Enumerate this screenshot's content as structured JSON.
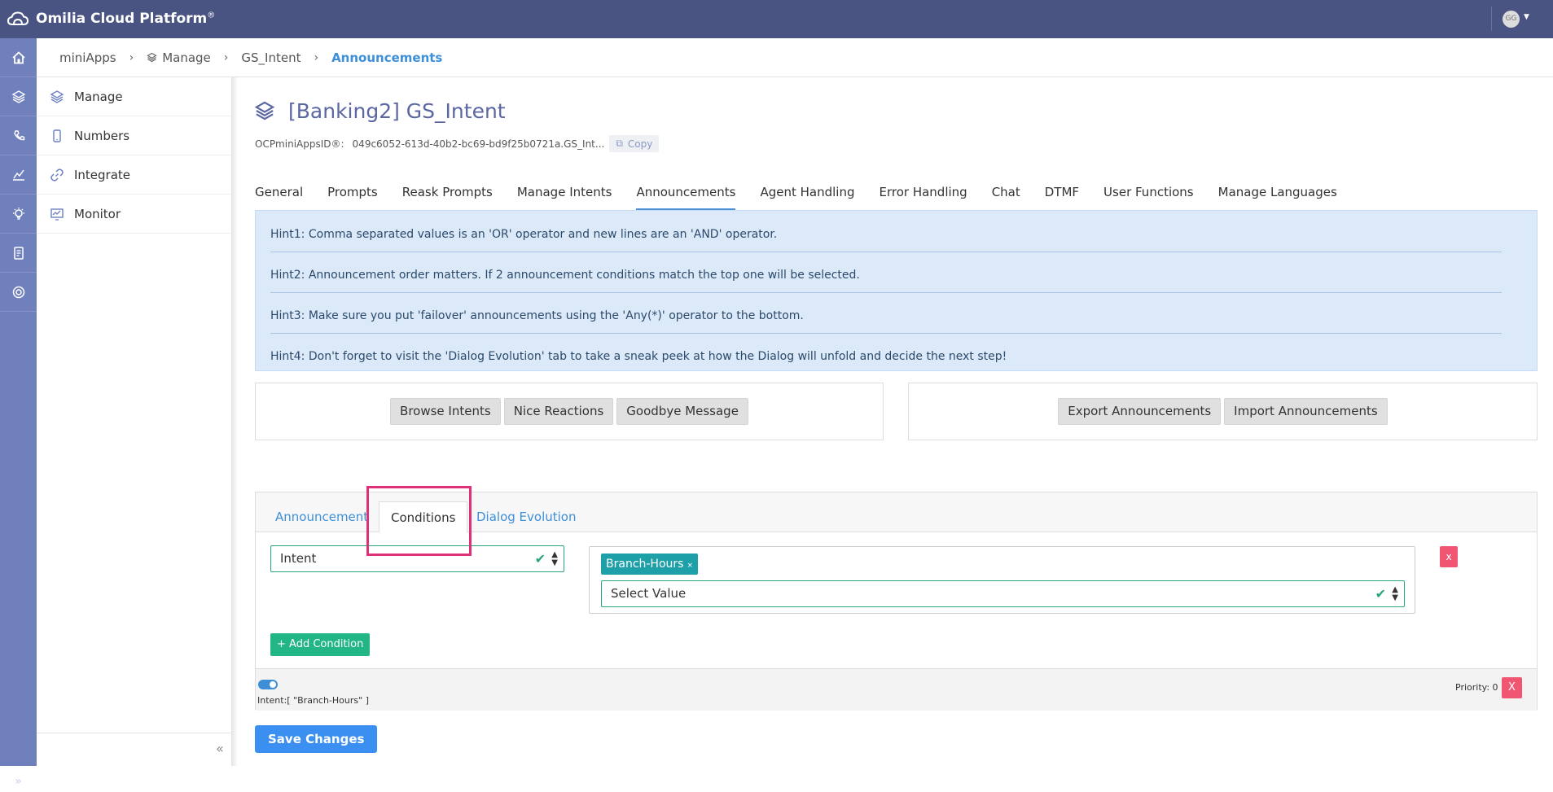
{
  "app": {
    "title": "Omilia Cloud Platform",
    "title_mark": "®",
    "avatar_initials": "GG"
  },
  "breadcrumb": [
    "miniApps",
    "Manage",
    "GS_Intent",
    "Announcements"
  ],
  "sidebar": {
    "items": [
      {
        "label": "Manage",
        "icon": "layers-icon"
      },
      {
        "label": "Numbers",
        "icon": "phone-icon"
      },
      {
        "label": "Integrate",
        "icon": "link-icon"
      },
      {
        "label": "Monitor",
        "icon": "monitor-icon"
      }
    ]
  },
  "rail": {
    "icons": [
      "home-icon",
      "layers-icon",
      "phone-book-icon",
      "chart-icon",
      "bulb-icon",
      "document-icon",
      "support-icon"
    ]
  },
  "page": {
    "title": "[Banking2] GS_Intent",
    "appid_label": "OCPminiAppsID®:",
    "appid_value": "049c6052-613d-40b2-bc69-bd9f25b0721a.GS_Int...",
    "copy_label": "Copy"
  },
  "tabs": [
    "General",
    "Prompts",
    "Reask Prompts",
    "Manage Intents",
    "Announcements",
    "Agent Handling",
    "Error Handling",
    "Chat",
    "DTMF",
    "User Functions",
    "Manage Languages"
  ],
  "hints": [
    "Hint1: Comma separated values is an 'OR' operator and new lines are an 'AND' operator.",
    "Hint2: Announcement order matters. If 2 announcement conditions match the top one will be selected.",
    "Hint3: Make sure you put 'failover' announcements using the 'Any(*)' operator to the bottom.",
    "Hint4: Don't forget to visit the 'Dialog Evolution' tab to take a sneak peek at how the Dialog will unfold and decide the next step!"
  ],
  "left_toolbar": [
    "Browse Intents",
    "Nice Reactions",
    "Goodbye Message"
  ],
  "right_toolbar": [
    "Export Announcements",
    "Import Announcements"
  ],
  "cond_tabs": [
    "Announcement",
    "Conditions",
    "Dialog Evolution"
  ],
  "condition": {
    "field": "Intent",
    "tag": "Branch-Hours",
    "tag_remove": "×",
    "value_placeholder": "Select Value",
    "remove_label": "x",
    "add_label": "+ Add Condition"
  },
  "footer": {
    "summary": "Intent:[ \"Branch-Hours\" ]",
    "priority": "Priority: 0",
    "remove_label": "X",
    "toggle_on": true
  },
  "save_label": "Save Changes",
  "colors": {
    "topbar": "#4a5482",
    "rail": "#7080bd",
    "accent": "#3d8fd8",
    "success": "#22b585",
    "danger": "#f05672",
    "highlight": "#e0307a"
  }
}
